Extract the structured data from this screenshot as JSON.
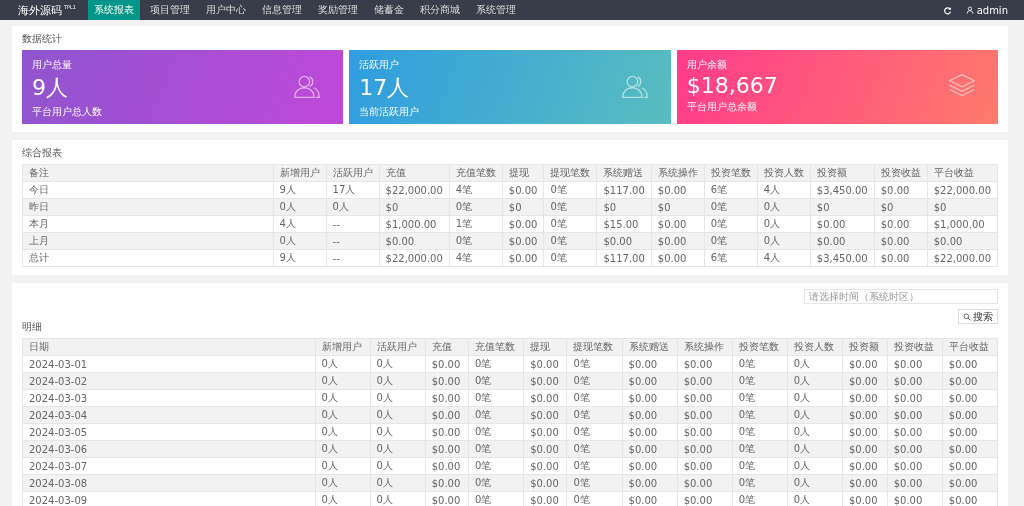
{
  "header": {
    "logo": "海外源码",
    "logo_sup": "TPL1",
    "nav": [
      {
        "label": "系统报表",
        "selected": true
      },
      {
        "label": "项目管理",
        "selected": false
      },
      {
        "label": "用户中心",
        "selected": false
      },
      {
        "label": "信息管理",
        "selected": false
      },
      {
        "label": "奖励管理",
        "selected": false
      },
      {
        "label": "储蓄金",
        "selected": false
      },
      {
        "label": "积分商城",
        "selected": false
      },
      {
        "label": "系统管理",
        "selected": false
      }
    ],
    "user": "admin"
  },
  "stats": {
    "title": "数据统计",
    "cards": [
      {
        "label": "用户总量",
        "value": "9人",
        "note": "平台用户总人数",
        "kind": "users"
      },
      {
        "label": "活跃用户",
        "value": "17人",
        "note": "当前活跃用户",
        "kind": "users"
      },
      {
        "label": "用户余额",
        "value": "$18,667",
        "note": "平台用户总余额",
        "kind": "stack"
      }
    ]
  },
  "summary": {
    "title": "综合报表",
    "columns": [
      "备注",
      "新增用户",
      "活跃用户",
      "充值",
      "充值笔数",
      "提现",
      "提现笔数",
      "系统赠送",
      "系统操作",
      "投资笔数",
      "投资人数",
      "投资额",
      "投资收益",
      "平台收益"
    ],
    "rows": [
      [
        "今日",
        "9人",
        "17人",
        "$22,000.00",
        "4笔",
        "$0.00",
        "0笔",
        "$117.00",
        "$0.00",
        "6笔",
        "4人",
        "$3,450.00",
        "$0.00",
        "$22,000.00"
      ],
      [
        "昨日",
        "0人",
        "0人",
        "$0",
        "0笔",
        "$0",
        "0笔",
        "$0",
        "$0",
        "0笔",
        "0人",
        "$0",
        "$0",
        "$0"
      ],
      [
        "本月",
        "4人",
        "--",
        "$1,000.00",
        "1笔",
        "$0.00",
        "0笔",
        "$15.00",
        "$0.00",
        "0笔",
        "0人",
        "$0.00",
        "$0.00",
        "$1,000.00"
      ],
      [
        "上月",
        "0人",
        "--",
        "$0.00",
        "0笔",
        "$0.00",
        "0笔",
        "$0.00",
        "$0.00",
        "0笔",
        "0人",
        "$0.00",
        "$0.00",
        "$0.00"
      ],
      [
        "总计",
        "9人",
        "--",
        "$22,000.00",
        "4笔",
        "$0.00",
        "0笔",
        "$117.00",
        "$0.00",
        "6笔",
        "4人",
        "$3,450.00",
        "$0.00",
        "$22,000.00"
      ]
    ]
  },
  "detail": {
    "date_placeholder": "请选择时间（系统时区）",
    "search_button": "搜索",
    "title": "明细",
    "columns": [
      "日期",
      "新增用户",
      "活跃用户",
      "充值",
      "充值笔数",
      "提现",
      "提现笔数",
      "系统赠送",
      "系统操作",
      "投资笔数",
      "投资人数",
      "投资额",
      "投资收益",
      "平台收益"
    ],
    "rows": [
      [
        "2024-03-01",
        "0人",
        "0人",
        "$0.00",
        "0笔",
        "$0.00",
        "0笔",
        "$0.00",
        "$0.00",
        "0笔",
        "0人",
        "$0.00",
        "$0.00",
        "$0.00"
      ],
      [
        "2024-03-02",
        "0人",
        "0人",
        "$0.00",
        "0笔",
        "$0.00",
        "0笔",
        "$0.00",
        "$0.00",
        "0笔",
        "0人",
        "$0.00",
        "$0.00",
        "$0.00"
      ],
      [
        "2024-03-03",
        "0人",
        "0人",
        "$0.00",
        "0笔",
        "$0.00",
        "0笔",
        "$0.00",
        "$0.00",
        "0笔",
        "0人",
        "$0.00",
        "$0.00",
        "$0.00"
      ],
      [
        "2024-03-04",
        "0人",
        "0人",
        "$0.00",
        "0笔",
        "$0.00",
        "0笔",
        "$0.00",
        "$0.00",
        "0笔",
        "0人",
        "$0.00",
        "$0.00",
        "$0.00"
      ],
      [
        "2024-03-05",
        "0人",
        "0人",
        "$0.00",
        "0笔",
        "$0.00",
        "0笔",
        "$0.00",
        "$0.00",
        "0笔",
        "0人",
        "$0.00",
        "$0.00",
        "$0.00"
      ],
      [
        "2024-03-06",
        "0人",
        "0人",
        "$0.00",
        "0笔",
        "$0.00",
        "0笔",
        "$0.00",
        "$0.00",
        "0笔",
        "0人",
        "$0.00",
        "$0.00",
        "$0.00"
      ],
      [
        "2024-03-07",
        "0人",
        "0人",
        "$0.00",
        "0笔",
        "$0.00",
        "0笔",
        "$0.00",
        "$0.00",
        "0笔",
        "0人",
        "$0.00",
        "$0.00",
        "$0.00"
      ],
      [
        "2024-03-08",
        "0人",
        "0人",
        "$0.00",
        "0笔",
        "$0.00",
        "0笔",
        "$0.00",
        "$0.00",
        "0笔",
        "0人",
        "$0.00",
        "$0.00",
        "$0.00"
      ],
      [
        "2024-03-09",
        "0人",
        "0人",
        "$0.00",
        "0笔",
        "$0.00",
        "0笔",
        "$0.00",
        "$0.00",
        "0笔",
        "0人",
        "$0.00",
        "$0.00",
        "$0.00"
      ]
    ]
  }
}
